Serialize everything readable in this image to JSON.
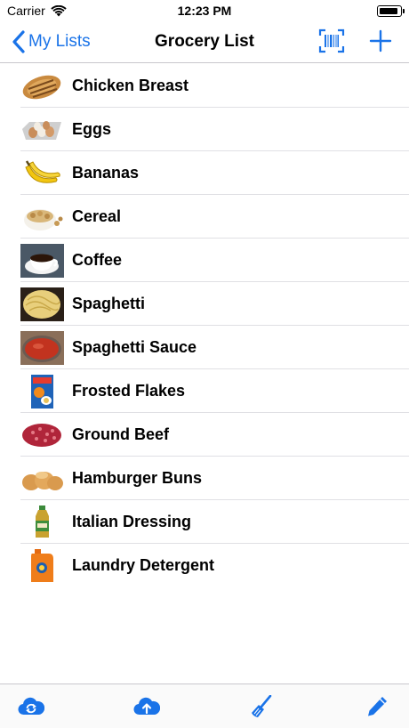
{
  "status_bar": {
    "carrier": "Carrier",
    "time": "12:23 PM",
    "battery_level": 0.95
  },
  "nav": {
    "back_label": "My Lists",
    "title": "Grocery List",
    "icons": [
      "chevron-left-icon",
      "barcode-scan-icon",
      "plus-icon"
    ]
  },
  "items": [
    {
      "name": "Chicken Breast",
      "icon": "chicken-breast-thumbnail"
    },
    {
      "name": "Eggs",
      "icon": "eggs-thumbnail"
    },
    {
      "name": "Bananas",
      "icon": "bananas-thumbnail"
    },
    {
      "name": "Cereal",
      "icon": "cereal-thumbnail"
    },
    {
      "name": "Coffee",
      "icon": "coffee-thumbnail"
    },
    {
      "name": "Spaghetti",
      "icon": "spaghetti-thumbnail"
    },
    {
      "name": "Spaghetti Sauce",
      "icon": "spaghetti-sauce-thumbnail"
    },
    {
      "name": "Frosted Flakes",
      "icon": "frosted-flakes-thumbnail"
    },
    {
      "name": "Ground Beef",
      "icon": "ground-beef-thumbnail"
    },
    {
      "name": "Hamburger Buns",
      "icon": "hamburger-buns-thumbnail"
    },
    {
      "name": "Italian Dressing",
      "icon": "italian-dressing-thumbnail"
    },
    {
      "name": "Laundry Detergent",
      "icon": "laundry-detergent-thumbnail"
    }
  ],
  "tab_bar": {
    "icons": [
      "cloud-sync-icon",
      "cloud-upload-icon",
      "broom-icon",
      "pencil-icon"
    ]
  },
  "colors": {
    "accent": "#1a73e8",
    "separator": "#e0e0e4",
    "text": "#000000"
  }
}
